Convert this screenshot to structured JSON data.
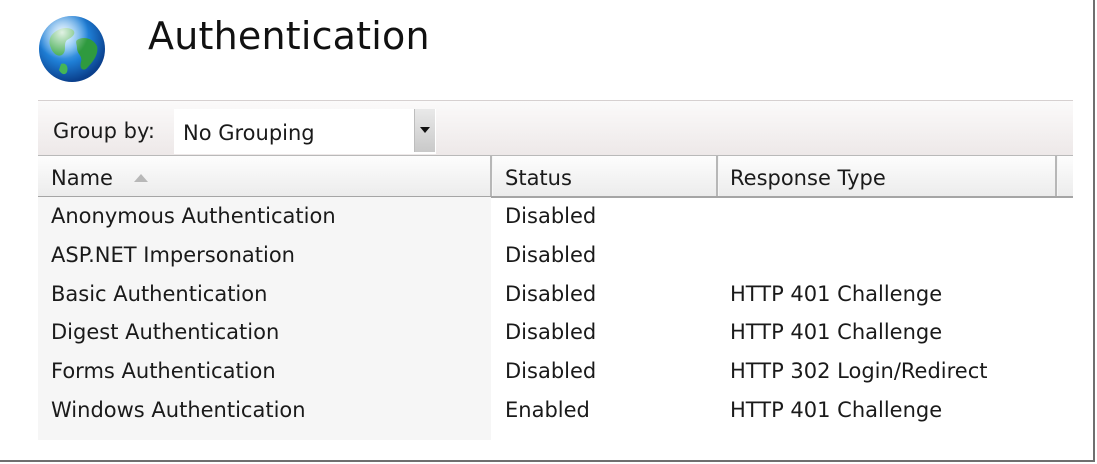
{
  "page": {
    "title": "Authentication",
    "icon": "globe-icon"
  },
  "toolbar": {
    "group_by_label": "Group by:",
    "group_by_value": "No Grouping",
    "dropdown_icon": "chevron-down-icon"
  },
  "table": {
    "columns": [
      {
        "label": "Name",
        "sorted": "ascending"
      },
      {
        "label": "Status"
      },
      {
        "label": "Response Type"
      }
    ],
    "rows": [
      {
        "name": "Anonymous Authentication",
        "status": "Disabled",
        "response_type": ""
      },
      {
        "name": "ASP.NET Impersonation",
        "status": "Disabled",
        "response_type": ""
      },
      {
        "name": "Basic Authentication",
        "status": "Disabled",
        "response_type": "HTTP 401 Challenge"
      },
      {
        "name": "Digest Authentication",
        "status": "Disabled",
        "response_type": "HTTP 401 Challenge"
      },
      {
        "name": "Forms Authentication",
        "status": "Disabled",
        "response_type": "HTTP 302 Login/Redirect"
      },
      {
        "name": "Windows Authentication",
        "status": "Enabled",
        "response_type": "HTTP 401 Challenge"
      }
    ]
  },
  "colors": {
    "toolbar_bg": "#f3efef",
    "header_bg": "#f2f2f2",
    "name_column_bg": "#f6f6f6",
    "text": "#1a1a1a"
  }
}
